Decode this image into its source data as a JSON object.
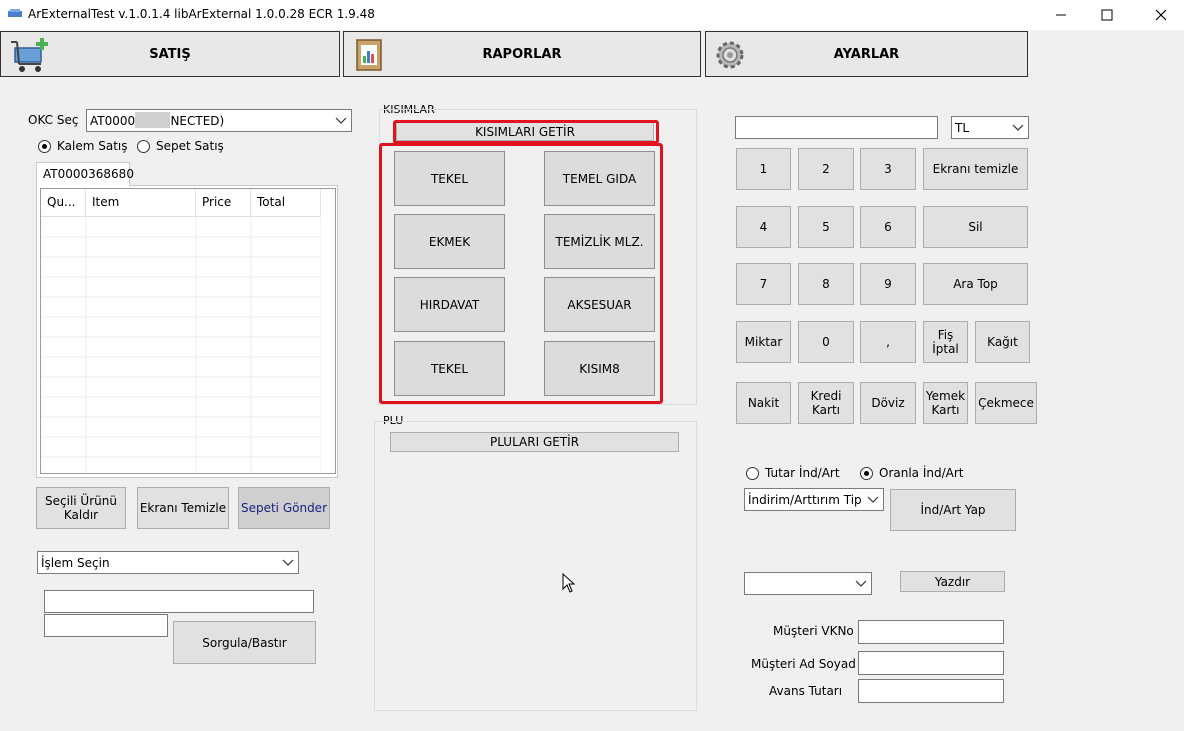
{
  "window": {
    "title": "ArExternalTest v.1.0.1.4 libArExternal 1.0.0.28 ECR 1.9.48"
  },
  "nav": {
    "satis": "SATIŞ",
    "raporlar": "RAPORLAR",
    "ayarlar": "AYARLAR"
  },
  "okc": {
    "label": "OKC Seç",
    "value": "AT0000       (CONNECTED)",
    "mode_item": "Kalem Satış",
    "mode_basket": "Sepet Satış",
    "tab": "AT0000368680"
  },
  "grid": {
    "columns": [
      "Qu...",
      "Item",
      "Price",
      "Total"
    ]
  },
  "left_buttons": {
    "remove_selected": "Seçili Ürünü Kaldır",
    "clear_screen": "Ekranı Temizle",
    "send_basket": "Sepeti Gönder"
  },
  "operation": {
    "select_value": "İşlem Seçin",
    "query_button": "Sorgula/Bastır"
  },
  "kisimlar": {
    "title": "KISIMLAR",
    "fetch_button": "KISIMLARI GETİR",
    "items": [
      "TEKEL",
      "TEMEL GIDA",
      "EKMEK",
      "TEMİZLİK MLZ.",
      "HIRDAVAT",
      "AKSESUAR",
      "TEKEL",
      "KISIM8"
    ]
  },
  "plu": {
    "title": "PLU",
    "fetch_button": "PLULARI GETİR"
  },
  "keypad": {
    "currency": "TL",
    "digits": [
      "1",
      "2",
      "3",
      "4",
      "5",
      "6",
      "7",
      "8",
      "9",
      "0",
      ","
    ],
    "clear_screen": "Ekranı temizle",
    "delete": "Sil",
    "subtotal": "Ara Top",
    "quantity": "Miktar",
    "cancel_receipt": "Fiş İptal",
    "paper": "Kağıt",
    "cash": "Nakit",
    "credit_card": "Kredi Kartı",
    "currency_btn": "Döviz",
    "meal_card": "Yemek Kartı",
    "drawer": "Çekmece"
  },
  "discount": {
    "amount_option": "Tutar İnd/Art",
    "rate_option": "Oranla İnd/Art",
    "type_select": "İndirim/Arttırım Tip",
    "apply_button": "İnd/Art Yap"
  },
  "print": {
    "button": "Yazdır"
  },
  "customer": {
    "vkn_label": "Müşteri VKNo",
    "name_label": "Müşteri Ad Soyad",
    "advance_label": "Avans Tutarı"
  }
}
